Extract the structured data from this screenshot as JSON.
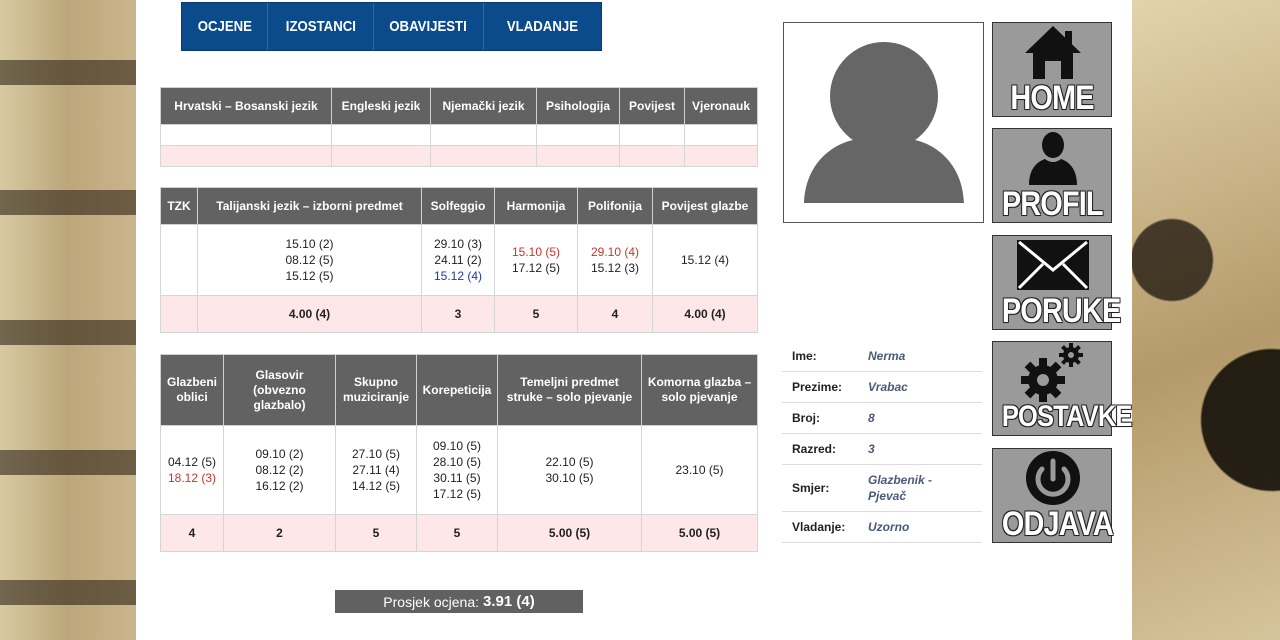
{
  "nav": [
    "OCJENE",
    "IZOSTANCI",
    "OBAVIJESTI",
    "VLADANJE"
  ],
  "table1": {
    "headers": [
      "Hrvatski – Bosanski jezik",
      "Engleski jezik",
      "Njemački jezik",
      "Psihologija",
      "Povijest",
      "Vjeronauk"
    ]
  },
  "table2": {
    "headers": [
      "TZK",
      "Talijanski jezik – izborni predmet",
      "Solfeggio",
      "Harmonija",
      "Polifonija",
      "Povijest glazbe"
    ],
    "grades": [
      [],
      [
        "15.10 (2)",
        "08.12 (5)",
        "15.12 (5)"
      ],
      [
        "29.10 (3)",
        "24.11 (2)",
        "15.12 (4)"
      ],
      [
        "15.10 (5)",
        "17.12 (5)"
      ],
      [
        "29.10 (4)",
        "15.12 (3)"
      ],
      [
        "15.12 (4)"
      ]
    ],
    "averages": [
      "",
      "4.00 (4)",
      "3",
      "5",
      "4",
      "4.00 (4)"
    ]
  },
  "table3": {
    "headers": [
      "Glazbeni oblici",
      "Glasovir (obvezno glazbalo)",
      "Skupno muziciranje",
      "Korepeticija",
      "Temeljni predmet struke – solo pjevanje",
      "Komorna glazba – solo pjevanje"
    ],
    "grades": [
      [
        "04.12 (5)",
        "18.12 (3)"
      ],
      [
        "09.10 (2)",
        "08.12 (2)",
        "16.12 (2)"
      ],
      [
        "27.10 (5)",
        "27.11 (4)",
        "14.12 (5)"
      ],
      [
        "09.10 (5)",
        "28.10 (5)",
        "30.11 (5)",
        "17.12 (5)"
      ],
      [
        "22.10 (5)",
        "30.10 (5)"
      ],
      [
        "23.10 (5)"
      ]
    ],
    "averages": [
      "4",
      "2",
      "5",
      "5",
      "5.00 (5)",
      "5.00 (5)"
    ]
  },
  "overall": {
    "label": "Prosjek ocjena:",
    "value": "3.91 (4)"
  },
  "profile": {
    "fields": [
      {
        "key": "Ime:",
        "value": "Nerma"
      },
      {
        "key": "Prezime:",
        "value": "Vrabac"
      },
      {
        "key": "Broj:",
        "value": "8"
      },
      {
        "key": "Razred:",
        "value": "3"
      },
      {
        "key": "Smjer:",
        "value": "Glazbenik - Pjevač"
      },
      {
        "key": "Vladanje:",
        "value": "Uzorno"
      }
    ]
  },
  "side_menu": [
    {
      "label": "HOME",
      "icon": "home-icon"
    },
    {
      "label": "PROFIL",
      "icon": "user-icon"
    },
    {
      "label": "PORUKE",
      "icon": "envelope-icon"
    },
    {
      "label": "POSTAVKE",
      "icon": "gears-icon"
    },
    {
      "label": "ODJAVA",
      "icon": "power-icon"
    }
  ],
  "colors": {
    "nav": "#0b4a8b",
    "header": "#626262",
    "avg_row": "#fde7e9",
    "grade_red": "#c0392b",
    "grade_blue": "#1f3a9a"
  }
}
